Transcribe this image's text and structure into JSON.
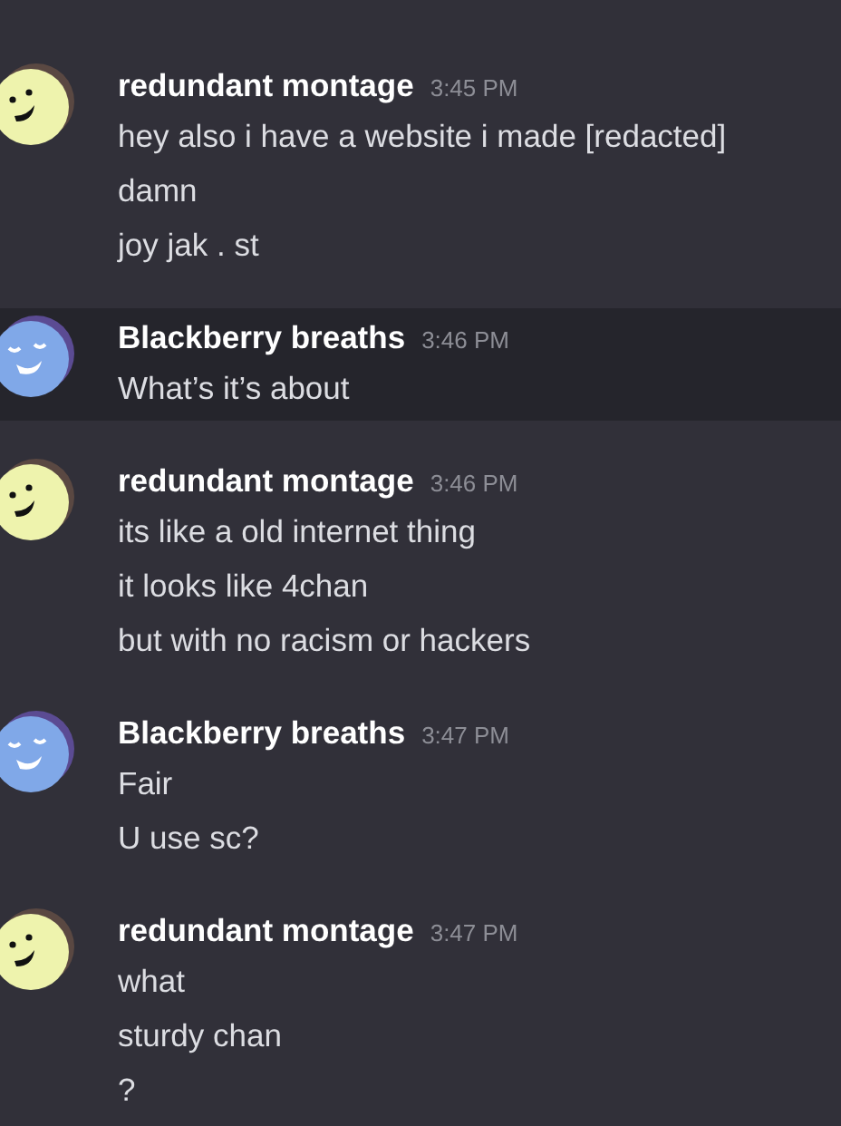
{
  "messages": [
    {
      "author": "redundant montage",
      "time": "3:45 PM",
      "kind": "smile",
      "color": "#eef3ad",
      "highlighted": false,
      "lines": [
        "hey also i have a website i made [redacted]",
        "damn",
        "joy jak . st"
      ]
    },
    {
      "author": "Blackberry breaths",
      "time": "3:46 PM",
      "kind": "content",
      "color": "#80a8e8",
      "highlighted": true,
      "lines": [
        "What’s it’s about"
      ]
    },
    {
      "author": "redundant montage",
      "time": "3:46 PM",
      "kind": "smile",
      "color": "#eef3ad",
      "highlighted": false,
      "lines": [
        "its like a old internet thing",
        "it looks like 4chan",
        "but with no racism or hackers"
      ]
    },
    {
      "author": "Blackberry breaths",
      "time": "3:47 PM",
      "kind": "content",
      "color": "#80a8e8",
      "highlighted": false,
      "lines": [
        "Fair",
        "U use sc?"
      ]
    },
    {
      "author": "redundant montage",
      "time": "3:47 PM",
      "kind": "smile",
      "color": "#eef3ad",
      "highlighted": false,
      "lines": [
        "what",
        "sturdy chan",
        "?"
      ]
    }
  ]
}
